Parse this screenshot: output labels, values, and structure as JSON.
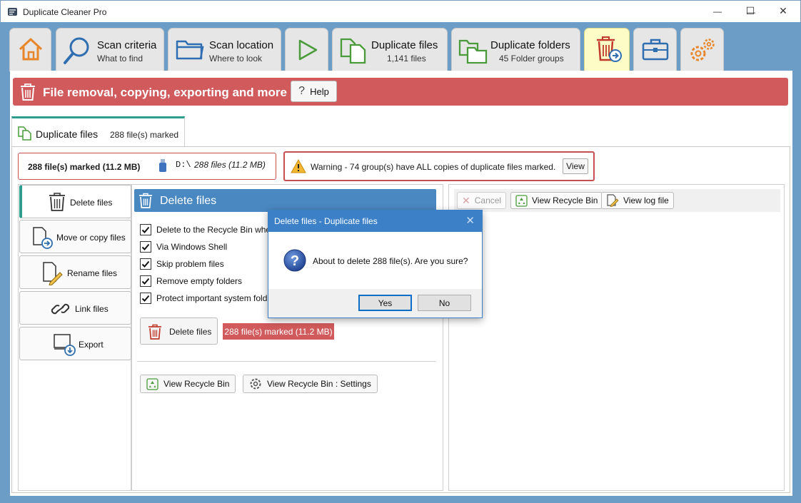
{
  "window": {
    "title": "Duplicate Cleaner Pro",
    "minimize_glyph": "—",
    "maximize_glyph": "☐",
    "close_glyph": "✕"
  },
  "ribbon": {
    "tabs": [
      {
        "id": "home",
        "icon": "house-icon"
      },
      {
        "id": "scan-criteria",
        "title": "Scan criteria",
        "subtitle": "What to find",
        "icon": "magnifier-icon"
      },
      {
        "id": "scan-location",
        "title": "Scan location",
        "subtitle": "Where to look",
        "icon": "folder-icon"
      },
      {
        "id": "start-scan",
        "icon": "play-icon"
      },
      {
        "id": "duplicate-files",
        "title": "Duplicate files",
        "subtitle": "1,141 files",
        "icon": "duplicate-files-icon"
      },
      {
        "id": "duplicate-folders",
        "title": "Duplicate folders",
        "subtitle": "45 Folder groups",
        "icon": "duplicate-folders-icon"
      },
      {
        "id": "file-removal",
        "icon": "trash-move-icon",
        "active": true
      },
      {
        "id": "tools",
        "icon": "toolbox-icon"
      },
      {
        "id": "settings",
        "icon": "gears-icon"
      }
    ]
  },
  "banner": {
    "title": "File removal, copying, exporting and more",
    "help_label": "Help"
  },
  "subtab": {
    "title": "Duplicate files",
    "subtitle": "288 file(s) marked"
  },
  "info": {
    "marked": "288 file(s) marked (11.2 MB)",
    "drive": "D:\\",
    "drive_files": "288 files (11.2 MB)"
  },
  "warning": {
    "text": "Warning - 74 group(s) have ALL copies of duplicate files marked.",
    "view_label": "View"
  },
  "nav": {
    "items": [
      {
        "label": "Delete files",
        "icon": "trash-icon",
        "selected": true
      },
      {
        "label": "Move or copy files",
        "icon": "move-copy-icon"
      },
      {
        "label": "Rename files",
        "icon": "rename-icon"
      },
      {
        "label": "Link files",
        "icon": "link-icon"
      },
      {
        "label": "Export",
        "icon": "export-icon"
      }
    ]
  },
  "delete_panel": {
    "header": "Delete files",
    "options": [
      {
        "label": "Delete to the Recycle Bin whe",
        "checked": true
      },
      {
        "label": "Via Windows Shell",
        "checked": true
      },
      {
        "label": "Skip problem files",
        "checked": true
      },
      {
        "label": "Remove empty folders",
        "checked": true
      },
      {
        "label": "Protect important system fold",
        "checked": true
      }
    ],
    "delete_button": "Delete files",
    "marked_badge": "288 file(s) marked (11.2 MB)",
    "view_recycle_bin": "View Recycle Bin",
    "view_recycle_bin_settings": "View Recycle Bin : Settings"
  },
  "log_toolbar": {
    "cancel": "Cancel",
    "view_recycle_bin": "View Recycle Bin",
    "view_log": "View log file"
  },
  "dialog": {
    "title": "Delete files - Duplicate files",
    "message": "About to delete 288 file(s). Are you sure?",
    "yes": "Yes",
    "no": "No",
    "close_glyph": "✕"
  },
  "colors": {
    "accent_red": "#d05a5c",
    "header_blue": "#4a88c2",
    "teal": "#2e9c8e",
    "frame_blue": "#6c9dc6",
    "active_tab": "#fdfbc6"
  }
}
